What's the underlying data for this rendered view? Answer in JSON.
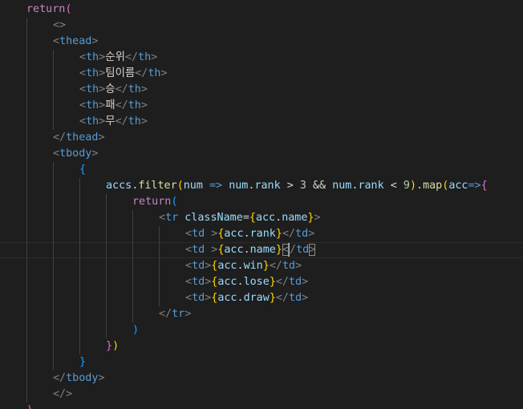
{
  "editor": {
    "language": "javascript-react",
    "current_line": 15,
    "colors": {
      "background": "#1e1e1e",
      "keyword": "#c586c0",
      "tag": "#569cd6",
      "tag_bracket": "#808080",
      "variable": "#9cdcfe",
      "function": "#dcdcaa",
      "number": "#b5cea8",
      "text": "#d4d4d4",
      "bracket_level_1": "#ffd700",
      "bracket_level_2": "#da70d6",
      "bracket_level_3": "#179fff"
    },
    "lines": [
      {
        "indent": 0,
        "tokens": [
          {
            "t": "return",
            "c": "kw"
          },
          {
            "t": "(",
            "c": "b2"
          }
        ]
      },
      {
        "indent": 1,
        "tokens": [
          {
            "t": "<>",
            "c": "tagb"
          }
        ]
      },
      {
        "indent": 1,
        "tokens": [
          {
            "t": "<",
            "c": "tagb"
          },
          {
            "t": "thead",
            "c": "tag"
          },
          {
            "t": ">",
            "c": "tagb"
          }
        ]
      },
      {
        "indent": 2,
        "tokens": [
          {
            "t": "<",
            "c": "tagb"
          },
          {
            "t": "th",
            "c": "tag"
          },
          {
            "t": ">",
            "c": "tagb"
          },
          {
            "t": "순위",
            "c": "text"
          },
          {
            "t": "</",
            "c": "tagb"
          },
          {
            "t": "th",
            "c": "tag"
          },
          {
            "t": ">",
            "c": "tagb"
          }
        ]
      },
      {
        "indent": 2,
        "tokens": [
          {
            "t": "<",
            "c": "tagb"
          },
          {
            "t": "th",
            "c": "tag"
          },
          {
            "t": ">",
            "c": "tagb"
          },
          {
            "t": "팀이름",
            "c": "text"
          },
          {
            "t": "</",
            "c": "tagb"
          },
          {
            "t": "th",
            "c": "tag"
          },
          {
            "t": ">",
            "c": "tagb"
          }
        ]
      },
      {
        "indent": 2,
        "tokens": [
          {
            "t": "<",
            "c": "tagb"
          },
          {
            "t": "th",
            "c": "tag"
          },
          {
            "t": ">",
            "c": "tagb"
          },
          {
            "t": "승",
            "c": "text"
          },
          {
            "t": "</",
            "c": "tagb"
          },
          {
            "t": "th",
            "c": "tag"
          },
          {
            "t": ">",
            "c": "tagb"
          }
        ]
      },
      {
        "indent": 2,
        "tokens": [
          {
            "t": "<",
            "c": "tagb"
          },
          {
            "t": "th",
            "c": "tag"
          },
          {
            "t": ">",
            "c": "tagb"
          },
          {
            "t": "패",
            "c": "text"
          },
          {
            "t": "</",
            "c": "tagb"
          },
          {
            "t": "th",
            "c": "tag"
          },
          {
            "t": ">",
            "c": "tagb"
          }
        ]
      },
      {
        "indent": 2,
        "tokens": [
          {
            "t": "<",
            "c": "tagb"
          },
          {
            "t": "th",
            "c": "tag"
          },
          {
            "t": ">",
            "c": "tagb"
          },
          {
            "t": "무",
            "c": "text"
          },
          {
            "t": "</",
            "c": "tagb"
          },
          {
            "t": "th",
            "c": "tag"
          },
          {
            "t": ">",
            "c": "tagb"
          }
        ]
      },
      {
        "indent": 1,
        "tokens": [
          {
            "t": "</",
            "c": "tagb"
          },
          {
            "t": "thead",
            "c": "tag"
          },
          {
            "t": ">",
            "c": "tagb"
          }
        ]
      },
      {
        "indent": 1,
        "tokens": [
          {
            "t": "<",
            "c": "tagb"
          },
          {
            "t": "tbody",
            "c": "tag"
          },
          {
            "t": ">",
            "c": "tagb"
          }
        ]
      },
      {
        "indent": 2,
        "tokens": [
          {
            "t": "{",
            "c": "b3"
          }
        ]
      },
      {
        "indent": 3,
        "tokens": [
          {
            "t": "accs",
            "c": "var"
          },
          {
            "t": ".",
            "c": "op"
          },
          {
            "t": "filter",
            "c": "fn"
          },
          {
            "t": "(",
            "c": "b1"
          },
          {
            "t": "num",
            "c": "var"
          },
          {
            "t": " ",
            "c": "op"
          },
          {
            "t": "=>",
            "c": "arrow"
          },
          {
            "t": " ",
            "c": "op"
          },
          {
            "t": "num",
            "c": "var"
          },
          {
            "t": ".",
            "c": "op"
          },
          {
            "t": "rank",
            "c": "var"
          },
          {
            "t": " > ",
            "c": "op"
          },
          {
            "t": "3",
            "c": "num"
          },
          {
            "t": " && ",
            "c": "op"
          },
          {
            "t": "num",
            "c": "var"
          },
          {
            "t": ".",
            "c": "op"
          },
          {
            "t": "rank",
            "c": "var"
          },
          {
            "t": " < ",
            "c": "op"
          },
          {
            "t": "9",
            "c": "num"
          },
          {
            "t": ")",
            "c": "b1"
          },
          {
            "t": ".",
            "c": "op"
          },
          {
            "t": "map",
            "c": "fn"
          },
          {
            "t": "(",
            "c": "b1"
          },
          {
            "t": "acc",
            "c": "var"
          },
          {
            "t": "=>",
            "c": "arrow"
          },
          {
            "t": "{",
            "c": "b2"
          }
        ]
      },
      {
        "indent": 4,
        "tokens": [
          {
            "t": "return",
            "c": "kw"
          },
          {
            "t": "(",
            "c": "b3"
          }
        ]
      },
      {
        "indent": 5,
        "tokens": [
          {
            "t": "<",
            "c": "tagb"
          },
          {
            "t": "tr",
            "c": "tag"
          },
          {
            "t": " ",
            "c": "op"
          },
          {
            "t": "className",
            "c": "attr"
          },
          {
            "t": "=",
            "c": "op"
          },
          {
            "t": "{",
            "c": "b1"
          },
          {
            "t": "acc",
            "c": "var"
          },
          {
            "t": ".",
            "c": "op"
          },
          {
            "t": "name",
            "c": "var"
          },
          {
            "t": "}",
            "c": "b1"
          },
          {
            "t": ">",
            "c": "tagb"
          }
        ]
      },
      {
        "indent": 6,
        "tokens": [
          {
            "t": "<",
            "c": "tagb"
          },
          {
            "t": "td",
            "c": "tag"
          },
          {
            "t": " >",
            "c": "tagb"
          },
          {
            "t": "{",
            "c": "b1"
          },
          {
            "t": "acc",
            "c": "var"
          },
          {
            "t": ".",
            "c": "op"
          },
          {
            "t": "rank",
            "c": "var"
          },
          {
            "t": "}",
            "c": "b1"
          },
          {
            "t": "</",
            "c": "tagb"
          },
          {
            "t": "td",
            "c": "tag"
          },
          {
            "t": ">",
            "c": "tagb"
          }
        ]
      },
      {
        "indent": 6,
        "tokens": [
          {
            "t": "<",
            "c": "tagb"
          },
          {
            "t": "td",
            "c": "tag"
          },
          {
            "t": " >",
            "c": "tagb"
          },
          {
            "t": "{",
            "c": "b1"
          },
          {
            "t": "acc",
            "c": "var"
          },
          {
            "t": ".",
            "c": "op"
          },
          {
            "t": "name",
            "c": "var"
          },
          {
            "t": "}",
            "c": "b1"
          },
          {
            "t": "<",
            "c": "tagb",
            "match": true
          },
          {
            "t": "CURSOR",
            "c": "cursor"
          },
          {
            "t": "/",
            "c": "tagb"
          },
          {
            "t": "td",
            "c": "tag"
          },
          {
            "t": ">",
            "c": "tagb",
            "match": true
          }
        ]
      },
      {
        "indent": 6,
        "tokens": [
          {
            "t": "<",
            "c": "tagb"
          },
          {
            "t": "td",
            "c": "tag"
          },
          {
            "t": ">",
            "c": "tagb"
          },
          {
            "t": "{",
            "c": "b1"
          },
          {
            "t": "acc",
            "c": "var"
          },
          {
            "t": ".",
            "c": "op"
          },
          {
            "t": "win",
            "c": "var"
          },
          {
            "t": "}",
            "c": "b1"
          },
          {
            "t": "</",
            "c": "tagb"
          },
          {
            "t": "td",
            "c": "tag"
          },
          {
            "t": ">",
            "c": "tagb"
          }
        ]
      },
      {
        "indent": 6,
        "tokens": [
          {
            "t": "<",
            "c": "tagb"
          },
          {
            "t": "td",
            "c": "tag"
          },
          {
            "t": ">",
            "c": "tagb"
          },
          {
            "t": "{",
            "c": "b1"
          },
          {
            "t": "acc",
            "c": "var"
          },
          {
            "t": ".",
            "c": "op"
          },
          {
            "t": "lose",
            "c": "var"
          },
          {
            "t": "}",
            "c": "b1"
          },
          {
            "t": "</",
            "c": "tagb"
          },
          {
            "t": "td",
            "c": "tag"
          },
          {
            "t": ">",
            "c": "tagb"
          }
        ]
      },
      {
        "indent": 6,
        "tokens": [
          {
            "t": "<",
            "c": "tagb"
          },
          {
            "t": "td",
            "c": "tag"
          },
          {
            "t": ">",
            "c": "tagb"
          },
          {
            "t": "{",
            "c": "b1"
          },
          {
            "t": "acc",
            "c": "var"
          },
          {
            "t": ".",
            "c": "op"
          },
          {
            "t": "draw",
            "c": "var"
          },
          {
            "t": "}",
            "c": "b1"
          },
          {
            "t": "</",
            "c": "tagb"
          },
          {
            "t": "td",
            "c": "tag"
          },
          {
            "t": ">",
            "c": "tagb"
          }
        ]
      },
      {
        "indent": 5,
        "tokens": [
          {
            "t": "</",
            "c": "tagb"
          },
          {
            "t": "tr",
            "c": "tag"
          },
          {
            "t": ">",
            "c": "tagb"
          }
        ]
      },
      {
        "indent": 4,
        "tokens": [
          {
            "t": ")",
            "c": "b3"
          }
        ]
      },
      {
        "indent": 3,
        "tokens": [
          {
            "t": "}",
            "c": "b2"
          },
          {
            "t": ")",
            "c": "b1"
          }
        ]
      },
      {
        "indent": 2,
        "tokens": [
          {
            "t": "}",
            "c": "b3"
          }
        ]
      },
      {
        "indent": 1,
        "tokens": [
          {
            "t": "</",
            "c": "tagb"
          },
          {
            "t": "tbody",
            "c": "tag"
          },
          {
            "t": ">",
            "c": "tagb"
          }
        ]
      },
      {
        "indent": 1,
        "tokens": [
          {
            "t": "</>",
            "c": "tagb"
          }
        ]
      },
      {
        "indent": 0,
        "tokens": [
          {
            "t": ")",
            "c": "b2"
          }
        ]
      }
    ]
  }
}
